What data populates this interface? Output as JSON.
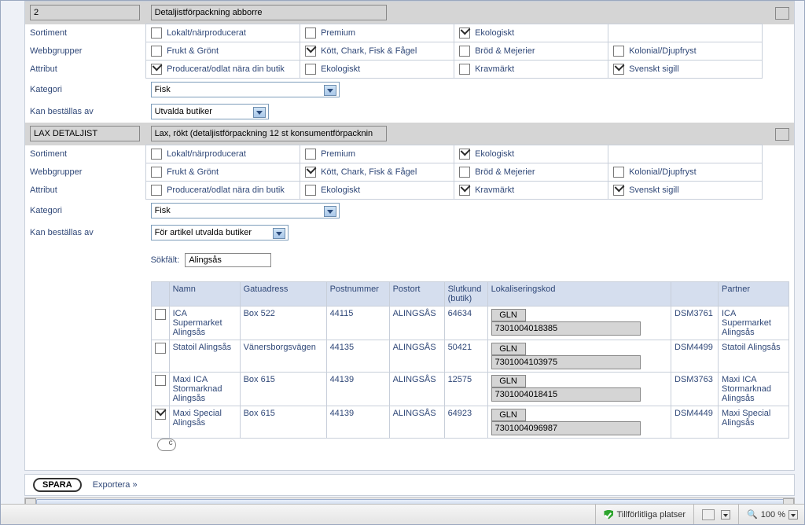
{
  "section1": {
    "id": "2",
    "title": "Detaljistförpackning abborre",
    "sortiment_label": "Sortiment",
    "sortiment": [
      {
        "label": "Lokalt/närproducerat",
        "checked": false
      },
      {
        "label": "Premium",
        "checked": false
      },
      {
        "label": "Ekologiskt",
        "checked": true
      }
    ],
    "webbgrupper_label": "Webbgrupper",
    "webbgrupper": [
      {
        "label": "Frukt & Grönt",
        "checked": false
      },
      {
        "label": "Kött, Chark, Fisk & Fågel",
        "checked": true
      },
      {
        "label": "Bröd & Mejerier",
        "checked": false
      },
      {
        "label": "Kolonial/Djupfryst",
        "checked": false
      }
    ],
    "attribut_label": "Attribut",
    "attribut": [
      {
        "label": "Producerat/odlat nära din butik",
        "checked": true
      },
      {
        "label": "Ekologiskt",
        "checked": false
      },
      {
        "label": "Kravmärkt",
        "checked": false
      },
      {
        "label": "Svenskt sigill",
        "checked": true
      }
    ],
    "kategori_label": "Kategori",
    "kategori_value": "Fisk",
    "kanbest_label": "Kan beställas av",
    "kanbest_value": "Utvalda butiker"
  },
  "section2": {
    "id": "LAX DETALJIST",
    "title": "Lax, rökt (detaljistförpackning 12 st konsumentförpacknin",
    "sortiment_label": "Sortiment",
    "sortiment": [
      {
        "label": "Lokalt/närproducerat",
        "checked": false
      },
      {
        "label": "Premium",
        "checked": false
      },
      {
        "label": "Ekologiskt",
        "checked": true
      }
    ],
    "webbgrupper_label": "Webbgrupper",
    "webbgrupper": [
      {
        "label": "Frukt & Grönt",
        "checked": false
      },
      {
        "label": "Kött, Chark, Fisk & Fågel",
        "checked": true
      },
      {
        "label": "Bröd & Mejerier",
        "checked": false
      },
      {
        "label": "Kolonial/Djupfryst",
        "checked": false
      }
    ],
    "attribut_label": "Attribut",
    "attribut": [
      {
        "label": "Producerat/odlat nära din butik",
        "checked": false
      },
      {
        "label": "Ekologiskt",
        "checked": false
      },
      {
        "label": "Kravmärkt",
        "checked": true
      },
      {
        "label": "Svenskt sigill",
        "checked": true
      }
    ],
    "kategori_label": "Kategori",
    "kategori_value": "Fisk",
    "kanbest_label": "Kan beställas av",
    "kanbest_value": "För artikel utvalda butiker"
  },
  "search": {
    "label": "Sökfält:",
    "value": "Alingsås"
  },
  "table": {
    "headers": {
      "namn": "Namn",
      "gatuadress": "Gatuadress",
      "postnummer": "Postnummer",
      "postort": "Postort",
      "slutkund": "Slutkund (butik)",
      "lokkod": "Lokaliseringskod",
      "partner": "Partner"
    },
    "gln_label": "GLN",
    "rows": [
      {
        "checked": false,
        "namn": "ICA Supermarket Alingsås",
        "gatuadress": "Box 522",
        "postnummer": "44115",
        "postort": "ALINGSÅS",
        "slutkund": "64634",
        "gln": "7301004018385",
        "partner_code": "DSM3761",
        "partner": "ICA Supermarket Alingsås"
      },
      {
        "checked": false,
        "namn": "Statoil Alingsås",
        "gatuadress": "Vänersborgsvägen",
        "postnummer": "44135",
        "postort": "ALINGSÅS",
        "slutkund": "50421",
        "gln": "7301004103975",
        "partner_code": "DSM4499",
        "partner": "Statoil Alingsås"
      },
      {
        "checked": false,
        "namn": "Maxi ICA Stormarknad Alingsås",
        "gatuadress": "Box 615",
        "postnummer": "44139",
        "postort": "ALINGSÅS",
        "slutkund": "12575",
        "gln": "7301004018415",
        "partner_code": "DSM3763",
        "partner": "Maxi ICA Stormarknad Alingsås"
      },
      {
        "checked": true,
        "namn": "Maxi Special Alingsås",
        "gatuadress": "Box 615",
        "postnummer": "44139",
        "postort": "ALINGSÅS",
        "slutkund": "64923",
        "gln": "7301004096987",
        "partner_code": "DSM4449",
        "partner": "Maxi Special Alingsås"
      }
    ]
  },
  "actions": {
    "spara": "SPARA",
    "exportera": "Exportera »"
  },
  "statusbar": {
    "trust": "Tillförlitliga platser",
    "zoom": "100 %"
  }
}
